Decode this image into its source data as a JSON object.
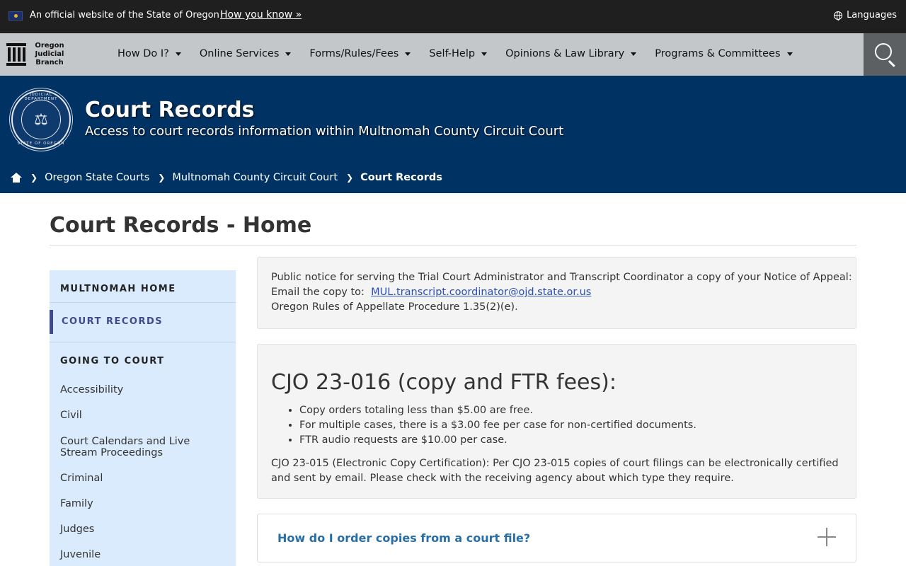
{
  "gov_banner": {
    "text": "An official website of the State of Oregon",
    "how_link": "How you know »",
    "languages": "Languages"
  },
  "navbar": {
    "logo_line1": "Oregon",
    "logo_line2": "Judicial",
    "logo_line3": "Branch",
    "items": [
      {
        "label": "How Do I?"
      },
      {
        "label": "Online Services"
      },
      {
        "label": "Forms/Rules/Fees"
      },
      {
        "label": "Self-Help"
      },
      {
        "label": "Opinions & Law Library"
      },
      {
        "label": "Programs & Committees"
      }
    ]
  },
  "hero": {
    "title": "Court Records",
    "subtitle": "Access to court records information within Multnomah County Circuit Court",
    "seal_top": "JUDICIAL DEPARTMENT",
    "seal_bottom": "STATE OF OREGON"
  },
  "breadcrumb": {
    "items": [
      "Oregon State Courts",
      "Multnomah County Circuit Court"
    ],
    "current": "Court Records"
  },
  "page": {
    "title": "Court Records - Home"
  },
  "sidebar": {
    "home": "MULTNOMAH HOME",
    "active": "COURT RECORDS",
    "section": "GOING TO COURT",
    "links": [
      "Accessibility",
      "Civil",
      "Court Calendars and Live Stream Proceedings",
      "Criminal",
      "Family",
      "Judges",
      "Juvenile"
    ]
  },
  "notice": {
    "line1": "Public notice for serving the Trial Court Administrator and Transcript Coordinator a copy of your Notice of Appeal:",
    "line2_prefix": "Email the copy to:",
    "email": "MUL.transcript.coordinator@ojd.state.or.us",
    "line3": "Oregon Rules of Appellate Procedure 1.35(2)(e)."
  },
  "cjo": {
    "heading": "CJO 23-016 (copy and FTR fees):",
    "bullets": [
      "Copy orders totaling less than $5.00 are free.",
      "For multiple cases, there is a $3.00 fee per case for non-certified documents.",
      "FTR audio requests are $10.00 per case."
    ],
    "paragraph": "CJO 23-015 (Electronic Copy Certification): Per CJO 23-015 copies of court filings can be electronically certified and sent by email. Please check with the receiving agency about which type they require."
  },
  "faq": {
    "question": "How do I order copies from a court file?"
  },
  "colors": {
    "hero_bg": "#003264",
    "nav_bg": "#c4c7c9",
    "sidebar_bg": "#d9ebfc",
    "accent": "#3d4a8c",
    "link": "#2a6ea6"
  }
}
